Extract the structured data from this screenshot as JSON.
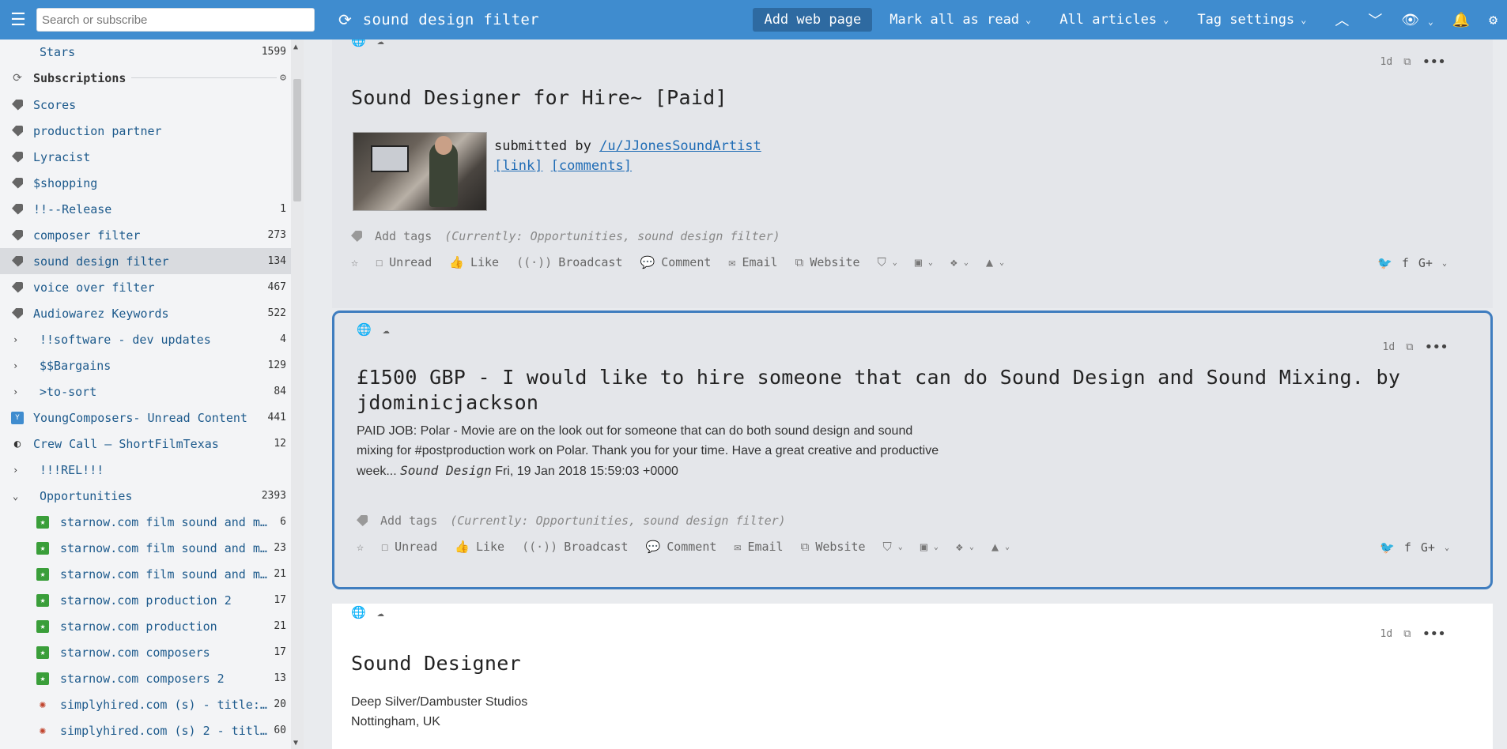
{
  "topbar": {
    "search_placeholder": "Search or subscribe",
    "feed_title": "sound design filter",
    "add_web_page": "Add web page",
    "mark_all_read": "Mark all as read",
    "all_articles": "All articles",
    "tag_settings": "Tag settings"
  },
  "sidebar": {
    "stars": {
      "label": "Stars",
      "count": "1599"
    },
    "subscriptions_header": "Subscriptions",
    "tags": [
      {
        "label": "Scores",
        "count": ""
      },
      {
        "label": "production partner",
        "count": ""
      },
      {
        "label": "Lyracist",
        "count": ""
      },
      {
        "label": "$shopping",
        "count": ""
      },
      {
        "label": "!!--Release",
        "count": "1"
      },
      {
        "label": "composer filter",
        "count": "273"
      },
      {
        "label": "sound design filter",
        "count": "134"
      },
      {
        "label": "voice over filter",
        "count": "467"
      },
      {
        "label": "Audiowarez Keywords",
        "count": "522"
      }
    ],
    "folders": [
      {
        "label": "!!software - dev updates",
        "count": "4"
      },
      {
        "label": "$$Bargains",
        "count": "129"
      },
      {
        "label": ">to-sort",
        "count": "84"
      }
    ],
    "feeds": [
      {
        "label": "YoungComposers- Unread Content",
        "count": "441"
      },
      {
        "label": "Crew Call – ShortFilmTexas",
        "count": "12"
      }
    ],
    "folder_rel": {
      "label": "!!!REL!!!",
      "count": ""
    },
    "opportunities": {
      "label": "Opportunities",
      "count": "2393"
    },
    "opp_items": [
      {
        "label": "starnow.com film sound and m…",
        "count": "6"
      },
      {
        "label": "starnow.com film sound and m…",
        "count": "23"
      },
      {
        "label": "starnow.com film sound and m…",
        "count": "21"
      },
      {
        "label": "starnow.com production 2",
        "count": "17"
      },
      {
        "label": "starnow.com production",
        "count": "21"
      },
      {
        "label": "starnow.com composers",
        "count": "17"
      },
      {
        "label": "starnow.com composers 2",
        "count": "13"
      },
      {
        "label": "simplyhired.com (s) - title:…",
        "count": "20"
      },
      {
        "label": "simplyhired.com (s) 2 - titl…",
        "count": "60"
      }
    ]
  },
  "articles": [
    {
      "age": "1d",
      "title": "Sound Designer for Hire~ [Paid]",
      "submitted_prefix": "submitted by",
      "user": "/u/JJonesSoundArtist",
      "link": "[link]",
      "comments": "[comments]",
      "add_tags": "Add tags",
      "currently": "(Currently: Opportunities, sound design filter)"
    },
    {
      "age": "1d",
      "title_line1": "£1500 GBP - I would like to hire someone that can do Sound Design and Sound Mixing. by",
      "title_line2": "jdominicjackson",
      "body_line1": "PAID JOB: Polar - Movie are on the look out for someone that can do both sound design and sound",
      "body_line2": "mixing for #postproduction work on Polar. Thank you for your time. Have a great creative and productive",
      "body_line3_a": "week...",
      "body_line3_b": "Sound Design",
      "body_line3_c": "Fri, 19 Jan 2018 15:59:03 +0000",
      "add_tags": "Add tags",
      "currently": "(Currently: Opportunities, sound design filter)"
    },
    {
      "age": "1d",
      "title": "Sound Designer",
      "body_line1": "Deep Silver/Dambuster Studios",
      "body_line2": "Nottingham, UK"
    }
  ],
  "actions": {
    "unread": "Unread",
    "like": "Like",
    "broadcast": "Broadcast",
    "comment": "Comment",
    "email": "Email",
    "website": "Website"
  }
}
